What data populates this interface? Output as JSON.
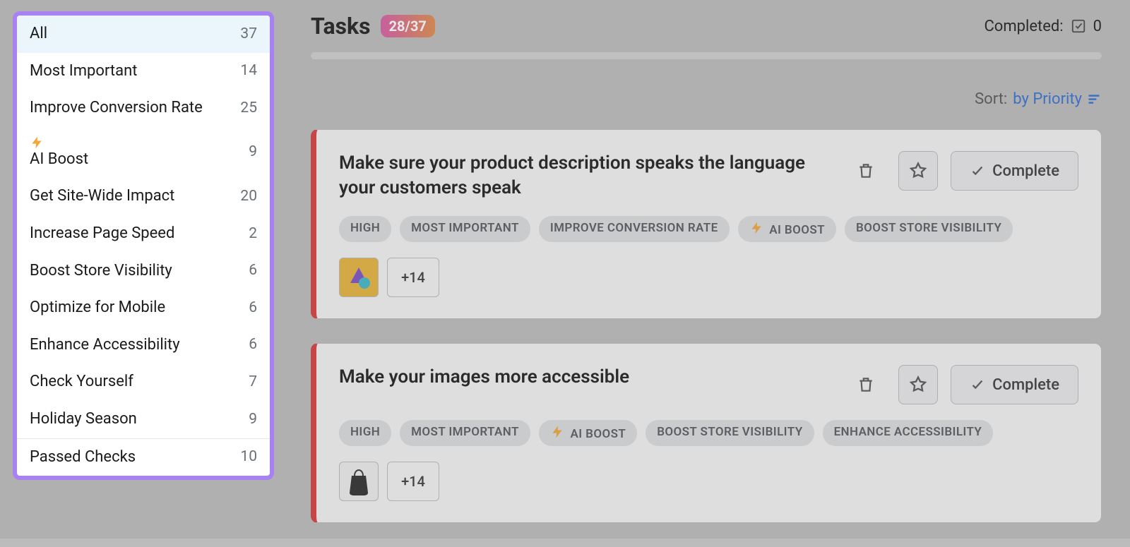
{
  "sidebar": {
    "items": [
      {
        "label": "All",
        "count": 37,
        "active": true,
        "icon": null
      },
      {
        "label": "Most Important",
        "count": 14,
        "active": false,
        "icon": null
      },
      {
        "label": "Improve Conversion Rate",
        "count": 25,
        "active": false,
        "icon": null
      },
      {
        "label": "AI Boost",
        "count": 9,
        "active": false,
        "icon": "bolt"
      },
      {
        "label": "Get Site-Wide Impact",
        "count": 20,
        "active": false,
        "icon": null
      },
      {
        "label": "Increase Page Speed",
        "count": 2,
        "active": false,
        "icon": null
      },
      {
        "label": "Boost Store Visibility",
        "count": 6,
        "active": false,
        "icon": null
      },
      {
        "label": "Optimize for Mobile",
        "count": 6,
        "active": false,
        "icon": null
      },
      {
        "label": "Enhance Accessibility",
        "count": 6,
        "active": false,
        "icon": null
      },
      {
        "label": "Check Yourself",
        "count": 7,
        "active": false,
        "icon": null
      },
      {
        "label": "Holiday Season",
        "count": 9,
        "active": false,
        "icon": null
      }
    ],
    "footer": {
      "label": "Passed Checks",
      "count": 10
    }
  },
  "header": {
    "title": "Tasks",
    "count_badge": "28/37",
    "completed_label": "Completed:",
    "completed_count": 0
  },
  "sort": {
    "label": "Sort:",
    "value": "by Priority"
  },
  "tasks": [
    {
      "title": "Make sure your product description speaks the language your customers speak",
      "tags": [
        "HIGH",
        "MOST IMPORTANT",
        "IMPROVE CONVERSION RATE",
        "⚡ AI BOOST",
        "BOOST STORE VISIBILITY"
      ],
      "more_thumbs": "+14",
      "complete_label": "Complete"
    },
    {
      "title": "Make your images more accessible",
      "tags": [
        "HIGH",
        "MOST IMPORTANT",
        "⚡ AI BOOST",
        "BOOST STORE VISIBILITY",
        "ENHANCE ACCESSIBILITY"
      ],
      "more_thumbs": "+14",
      "complete_label": "Complete"
    }
  ]
}
